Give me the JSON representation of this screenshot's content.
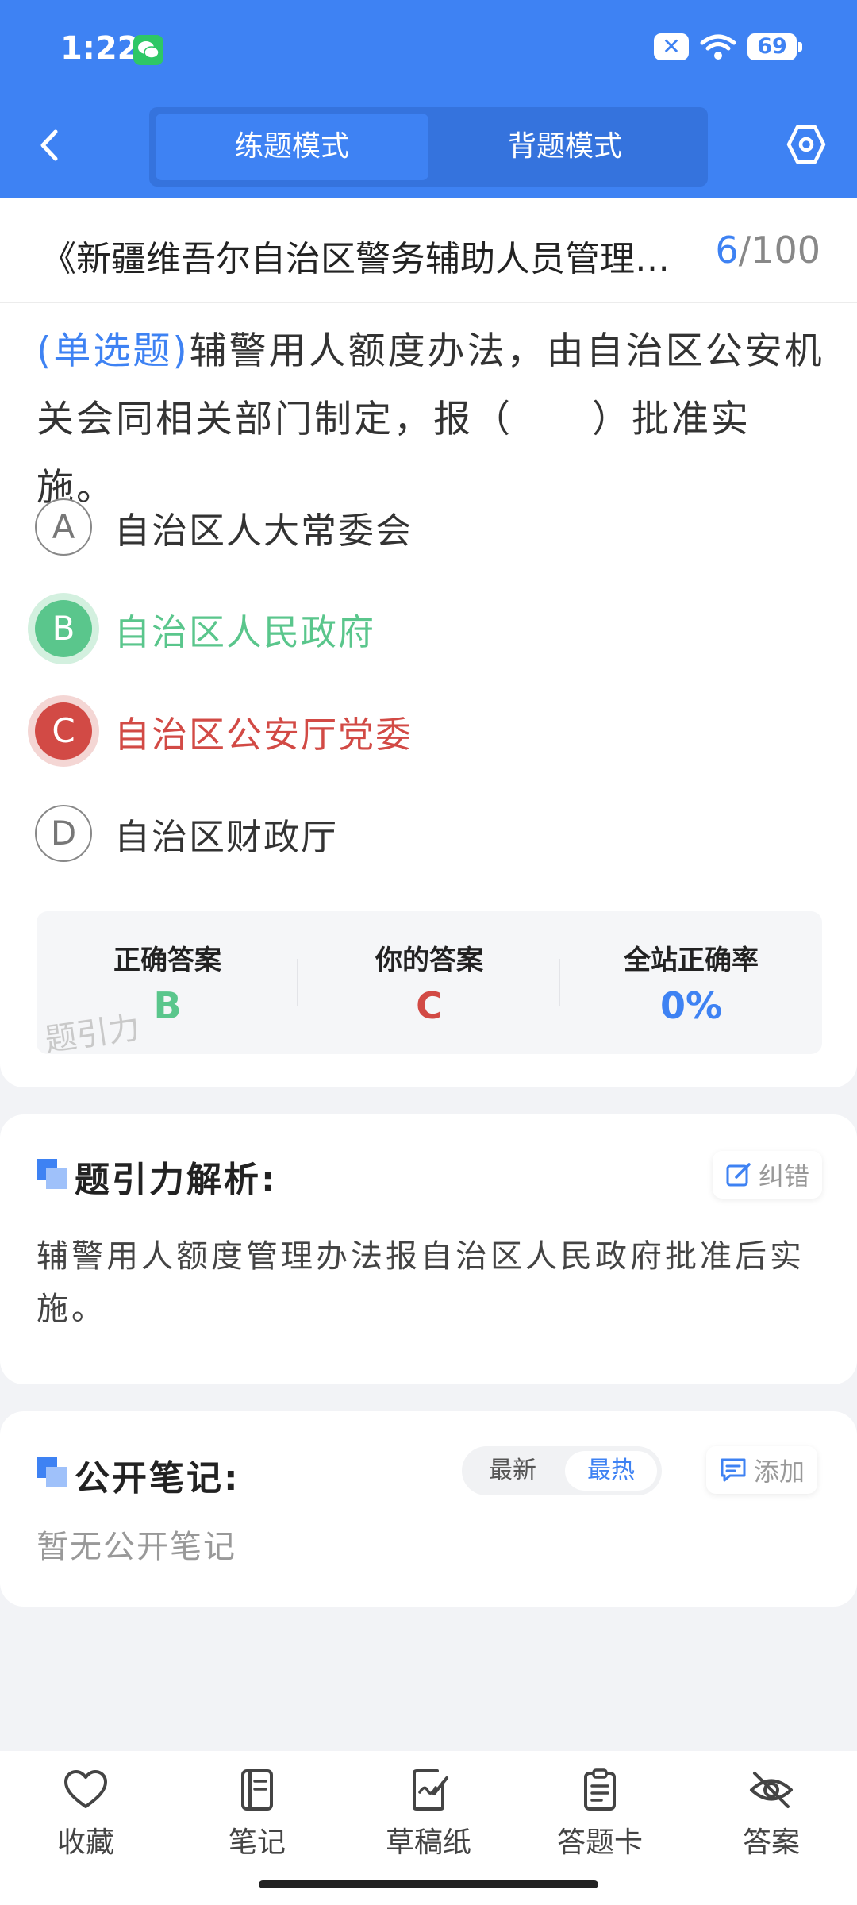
{
  "status_bar": {
    "time": "1:22",
    "battery": "69"
  },
  "header": {
    "mode_tabs": [
      {
        "label": "练题模式",
        "active": true
      },
      {
        "label": "背题模式",
        "active": false
      }
    ]
  },
  "question": {
    "title": "《新疆维吾尔自治区警务辅助人员管理办法》",
    "progress_current": "6",
    "progress_total": "/100",
    "type_label": "(单选题)",
    "text": "辅警用人额度办法，由自治区公安机关会同相关部门制定，报（　　）批准实施。",
    "options": [
      {
        "letter": "A",
        "text": "自治区人大常委会",
        "state": "normal"
      },
      {
        "letter": "B",
        "text": "自治区人民政府",
        "state": "correct"
      },
      {
        "letter": "C",
        "text": "自治区公安厅党委",
        "state": "wrong"
      },
      {
        "letter": "D",
        "text": "自治区财政厅",
        "state": "normal"
      }
    ]
  },
  "answer_summary": {
    "correct_label": "正确答案",
    "correct_value": "B",
    "yours_label": "你的答案",
    "yours_value": "C",
    "rate_label": "全站正确率",
    "rate_value": "0%",
    "watermark": "题引力"
  },
  "analysis": {
    "title": "题引力解析:",
    "report_label": "纠错",
    "text": "辅警用人额度管理办法报自治区人民政府批准后实施。"
  },
  "notes": {
    "title": "公开笔记:",
    "sort_newest": "最新",
    "sort_hottest": "最热",
    "add_label": "添加",
    "empty_text": "暂无公开笔记"
  },
  "bottom_nav": [
    {
      "label": "收藏",
      "icon": "heart-icon"
    },
    {
      "label": "笔记",
      "icon": "notebook-icon"
    },
    {
      "label": "草稿纸",
      "icon": "draft-paper-icon"
    },
    {
      "label": "答题卡",
      "icon": "answer-sheet-icon"
    },
    {
      "label": "答案",
      "icon": "eye-off-icon"
    }
  ],
  "colors": {
    "brand_blue": "#3e82f3",
    "correct_green": "#5ac68c",
    "wrong_red": "#d24a45"
  }
}
